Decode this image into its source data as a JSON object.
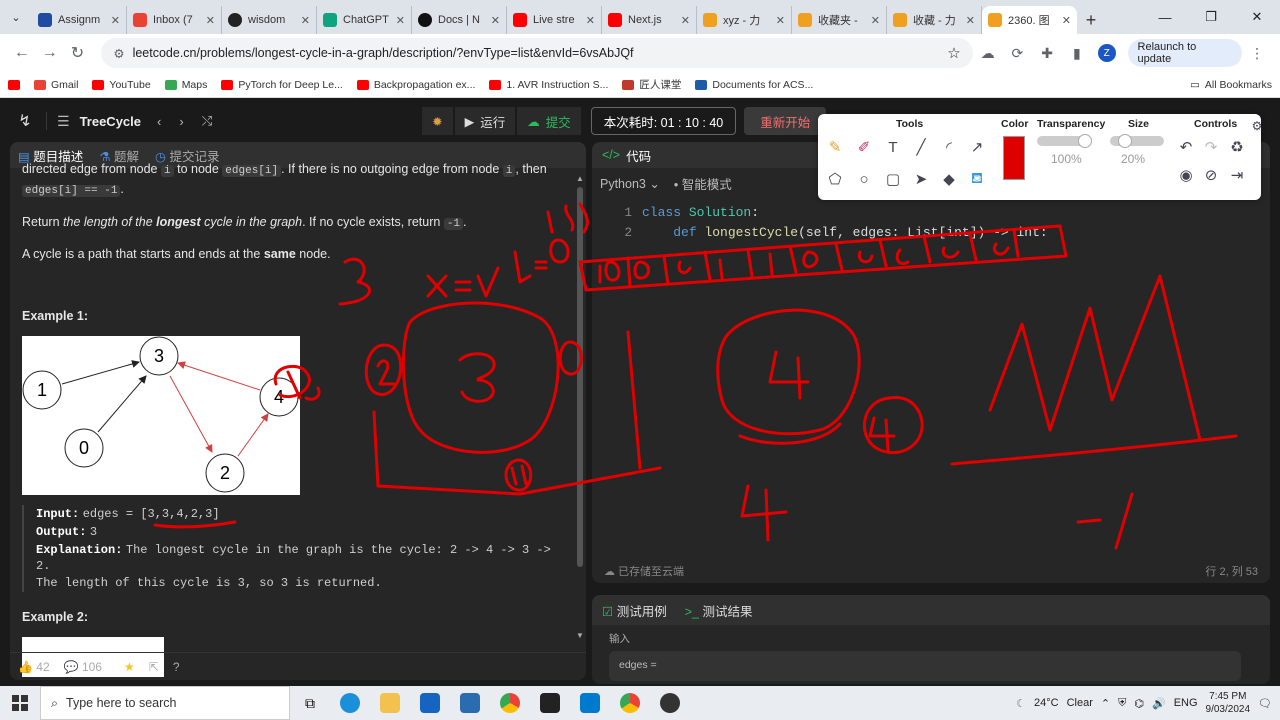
{
  "tabs": [
    {
      "title": "Assignm",
      "color": "#1f4ca0"
    },
    {
      "title": "Inbox (7",
      "color": "#ea4335"
    },
    {
      "title": "wisdom",
      "color": "#222222"
    },
    {
      "title": "ChatGPT",
      "color": "#10a37f"
    },
    {
      "title": "Docs | N",
      "color": "#111111"
    },
    {
      "title": "Live stre",
      "color": "#ff0000"
    },
    {
      "title": "Next.js",
      "color": "#ff0000"
    },
    {
      "title": "xyz - 力",
      "color": "#f0a020"
    },
    {
      "title": "收藏夹 -",
      "color": "#f0a020"
    },
    {
      "title": "收藏 - 力",
      "color": "#f0a020"
    },
    {
      "title": "2360. 图",
      "color": "#f0a020"
    }
  ],
  "url": "leetcode.cn/problems/longest-cycle-in-a-graph/description/?envType=list&envId=6vsAbJQf",
  "profile_initial": "Z",
  "relaunch": "Relaunch to update",
  "bookmarks": [
    {
      "label": "",
      "color": "#ff0000"
    },
    {
      "label": "Gmail",
      "color": "#ea4335"
    },
    {
      "label": "YouTube",
      "color": "#ff0000"
    },
    {
      "label": "Maps",
      "color": "#34a853"
    },
    {
      "label": "PyTorch for Deep Le...",
      "color": "#ff0000"
    },
    {
      "label": "Backpropagation ex...",
      "color": "#ff0000"
    },
    {
      "label": "1. AVR Instruction S...",
      "color": "#ff0000"
    },
    {
      "label": "匠人课堂",
      "color": "#c0392b"
    },
    {
      "label": "Documents for ACS...",
      "color": "#1e5aa8"
    }
  ],
  "all_bookmarks": "All Bookmarks",
  "lc": {
    "list_name": "TreeCycle",
    "run": "运行",
    "submit": "提交",
    "timer": "本次耗时: 01 : 10 : 40",
    "restart": "重新开始"
  },
  "left": {
    "tab_desc": "题目描述",
    "tab_solution": "题解",
    "tab_submissions": "提交记录",
    "line1a": "directed edge from node",
    "line1b": "to node",
    "line1c": ". If there is no outgoing edge from node",
    "line1d": ", then",
    "code_i": "i",
    "code_edges_i": "edges[i]",
    "code_neg": "edges[i] == -1",
    "return_a": "Return",
    "return_b": "the length of the",
    "return_c": "longest",
    "return_d": "cycle in the graph",
    "return_e": ". If no cycle exists, return",
    "return_f": "-1",
    "cycle_a": "A cycle is a path that starts and ends at the",
    "cycle_b": "same",
    "cycle_c": "node.",
    "example1": "Example 1:",
    "input_k": "Input:",
    "input_v": "edges = [3,3,4,2,3]",
    "output_k": "Output:",
    "output_v": "3",
    "expl_k": "Explanation:",
    "expl_v": "The longest cycle in the graph is the cycle: 2 -> 4 -> 3 ->",
    "expl_v2": "2.",
    "expl_v3": "The length of this cycle is 3, so 3 is returned.",
    "example2": "Example 2:",
    "likes": "42",
    "comments": "106",
    "graph_nodes": [
      "1",
      "3",
      "4",
      "0",
      "2"
    ]
  },
  "code": {
    "title": "代码",
    "lang": "Python3",
    "mode": "智能模式",
    "line1_num": "1",
    "line2_num": "2",
    "line1_kw": "class",
    "line1_name": "Solution",
    "line1_colon": ":",
    "line2_kw": "def",
    "line2_fn": "longestCycle",
    "line2_rest": "(self, edges: List[int]) -> int:",
    "saved": "已存储至云端",
    "cursor": "行 2, 列 53"
  },
  "test": {
    "tab_cases": "测试用例",
    "tab_result": "测试结果",
    "input_label": "输入",
    "edges_label": "edges ="
  },
  "annotate": {
    "tools": "Tools",
    "color": "Color",
    "transparency": "Transparency",
    "transparency_val": "100%",
    "size": "Size",
    "size_val": "20%",
    "controls": "Controls",
    "active_color": "#dd0000"
  },
  "taskbar": {
    "search": "Type here to search",
    "temp": "24°C",
    "weather": "Clear",
    "lang": "ENG",
    "time": "7:45 PM",
    "date": "9/03/2024"
  }
}
